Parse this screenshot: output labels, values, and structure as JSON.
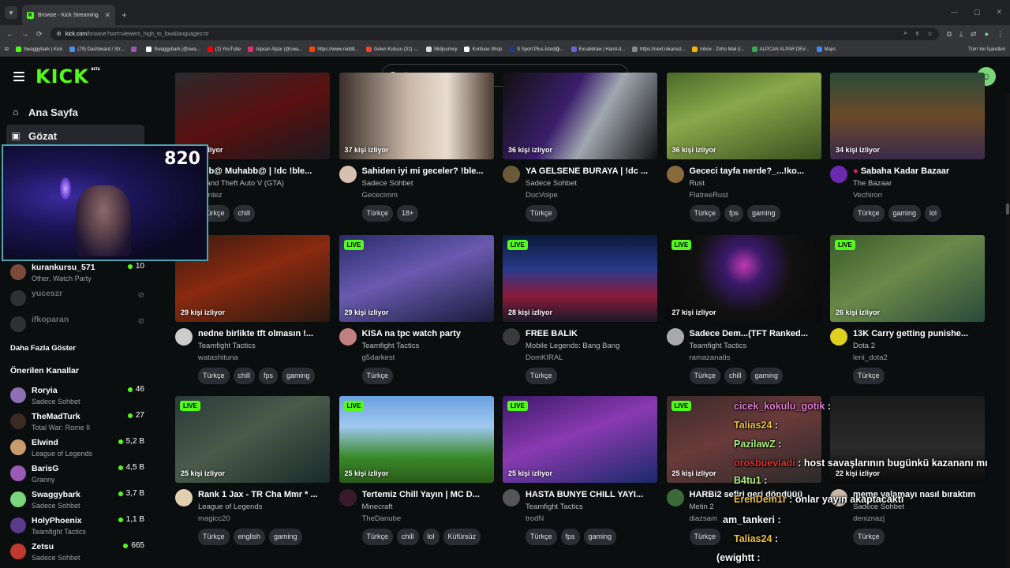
{
  "browser": {
    "tab_title": "Browse - Kick Streaming",
    "url_host": "kick.com",
    "url_path": "/browse?sort=viewers_high_to_low&languages=tr",
    "bookmarks": [
      {
        "label": "Swaggybark | Kick",
        "color": "#53fc18"
      },
      {
        "label": "(79) Dashboard / Str...",
        "color": "#4a90e2"
      },
      {
        "label": "",
        "color": "#9b59b6"
      },
      {
        "label": "Swaggybark (@swa...",
        "color": "#ffffff"
      },
      {
        "label": "(2) YouTube",
        "color": "#ff0000"
      },
      {
        "label": "Alpcan Alpar (@swa...",
        "color": "#e1306c"
      },
      {
        "label": "https://www.reddit...",
        "color": "#ff4500"
      },
      {
        "label": "Gelen Kutusu (31) -...",
        "color": "#ea4335"
      },
      {
        "label": "Midjourney",
        "color": "#dddddd"
      },
      {
        "label": "Konfuse Shop",
        "color": "#ffffff"
      },
      {
        "label": "S Sport Plus-İstediği...",
        "color": "#1e3a8a"
      },
      {
        "label": "Excalidraw | Hand-d...",
        "color": "#6965db"
      },
      {
        "label": "https://next.inkamat...",
        "color": "#888888"
      },
      {
        "label": "Inbox - Zoho Mail (i...",
        "color": "#f4b400"
      },
      {
        "label": "ALPCAN ALPAR DEV...",
        "color": "#34a853"
      },
      {
        "label": "Maps",
        "color": "#4285f4"
      }
    ],
    "bookmarks_right": "Tüm Yer İşaretleri"
  },
  "header": {
    "logo": "KICK",
    "logo_badge": "BETA",
    "search_placeholder": "Ara"
  },
  "sidebar": {
    "nav": [
      {
        "label": "Ana Sayfa",
        "icon": "home-icon",
        "active": false
      },
      {
        "label": "Gözat",
        "icon": "browse-icon",
        "active": true
      }
    ],
    "webcam_count": "820",
    "followed": [
      {
        "name": "kurankursu_571",
        "category": "Other, Watch Party",
        "viewers": "10",
        "online": true,
        "color": "#7a4a3a"
      },
      {
        "name": "yuceszr",
        "category": "",
        "viewers": "",
        "online": false,
        "color": "#555555"
      },
      {
        "name": "ifkoparan",
        "category": "",
        "viewers": "",
        "online": false,
        "color": "#555555"
      }
    ],
    "show_more": "Daha Fazla Göster",
    "recommended_title": "Önerilen Kanallar",
    "recommended": [
      {
        "name": "Roryia",
        "category": "Sadece Sohbet",
        "viewers": "46",
        "color": "#8e6fb5"
      },
      {
        "name": "TheMadTurk",
        "category": "Total War: Rome II",
        "viewers": "27",
        "color": "#3b2a24"
      },
      {
        "name": "Elwind",
        "category": "League of Legends",
        "viewers": "5,2 B",
        "color": "#c69c6d"
      },
      {
        "name": "BarisG",
        "category": "Granny",
        "viewers": "4,5 B",
        "color": "#9b59b6"
      },
      {
        "name": "Swaggybark",
        "category": "Sadece Sohbet",
        "viewers": "3,7 B",
        "color": "#7ad67a"
      },
      {
        "name": "HolyPhoenix",
        "category": "Teamfight Tactics",
        "viewers": "1,1 B",
        "color": "#5a3a8a"
      },
      {
        "name": "Zetsu",
        "category": "Sadece Sohbet",
        "viewers": "665",
        "color": "#c0392b"
      }
    ]
  },
  "cards": [
    {
      "live": false,
      "viewers": "... kişi izliyor",
      "title": "ohb@ Muhabb@ | !dc !ble...",
      "category": "Grand Theft Auto V (GTA)",
      "user": "leontez",
      "tags": [
        "Türkçe",
        "chill"
      ],
      "thumb": "linear-gradient(160deg,#2a2a2e 0%,#5a1010 50%,#1a1a1e 100%)",
      "avatar": "#333"
    },
    {
      "live": false,
      "viewers": "37 kişi izliyor",
      "title": "Sahiden iyi mi geceler? !ble...",
      "category": "Sadece Sohbet",
      "user": "Gececimm",
      "tags": [
        "Türkçe",
        "18+"
      ],
      "thumb": "linear-gradient(90deg,#3a2f2a 0%,#c9b8a8 45%,#e8dcd0 70%,#4a3a30 100%)",
      "avatar": "#d8c0b0"
    },
    {
      "live": false,
      "viewers": "36 kişi izliyor",
      "title": "YA GELSENE BURAYA | !dc ...",
      "category": "Sadece Sohbet",
      "user": "DucVolpe",
      "tags": [
        "Türkçe"
      ],
      "thumb": "linear-gradient(120deg,#111 0%,#3a1e6a 40%,#a0a8b0 60%,#111 100%)",
      "avatar": "#6a5a3a"
    },
    {
      "live": false,
      "viewers": "36 kişi izliyor",
      "title": "Gececi tayfa nerde?_...!ko...",
      "category": "Rust",
      "user": "FlatreeRust",
      "tags": [
        "Türkçe",
        "fps",
        "gaming"
      ],
      "thumb": "linear-gradient(160deg,#4a6a2a 0%,#8aa84a 40%,#3a5020 100%)",
      "avatar": "#8a6a3a"
    },
    {
      "live": false,
      "viewers": "34 kişi izliyor",
      "title": "Sabaha Kadar Bazaar",
      "category": "The Bazaar",
      "user": "Vechiron",
      "tags": [
        "Türkçe",
        "gaming",
        "lol"
      ],
      "thumb": "linear-gradient(180deg,#2a4a3a 0%,#6a4a2a 50%,#3a2a4a 100%)",
      "avatar": "#6a2ab0",
      "title_dot": true
    },
    {
      "live": false,
      "viewers": "29 kişi izliyor",
      "title": "nedne birlikte tft olmasın !...",
      "category": "Teamfight Tactics",
      "user": "watashituna",
      "tags": [
        "Türkçe",
        "chill",
        "fps",
        "gaming"
      ],
      "thumb": "linear-gradient(160deg,#3a1a10 0%,#8a2a10 45%,#2a1a10 100%)",
      "avatar": "#ccc"
    },
    {
      "live": true,
      "viewers": "29 kişi izliyor",
      "title": "KISA na tpc watch party",
      "category": "Teamfight Tactics",
      "user": "g5darkest",
      "tags": [
        "Türkçe"
      ],
      "thumb": "linear-gradient(160deg,#2a2a6a 0%,#6a5ab0 45%,#1a1a3a 100%)",
      "avatar": "#c08080"
    },
    {
      "live": true,
      "viewers": "28 kişi izliyor",
      "title": "FREE BALIK",
      "category": "Mobile Legends: Bang Bang",
      "user": "DomKIRAL",
      "tags": [
        "Türkçe"
      ],
      "thumb": "linear-gradient(180deg,#0a1a3a 0%,#2a3a8a 40%,#8a1a3a 70%,#1a1a2a 100%)",
      "avatar": "#3a3a3a"
    },
    {
      "live": true,
      "viewers": "27 kişi izliyor",
      "title": "Sadece Dem...(TFT Ranked...",
      "category": "Teamfight Tactics",
      "user": "ramazanatis",
      "tags": [
        "Türkçe",
        "chill",
        "gaming"
      ],
      "thumb": "radial-gradient(circle at 50% 35%,#c03ab0 0%,#3a1a6a 20%,#111 50%,#0a0a0a 100%)",
      "avatar": "#aaa"
    },
    {
      "live": true,
      "viewers": "26 kişi izliyor",
      "title": "13K Carry getting punishe...",
      "category": "Dota 2",
      "user": "leni_dota2",
      "tags": [
        "Türkçe"
      ],
      "thumb": "linear-gradient(150deg,#3a5a2a 0%,#6a8a4a 45%,#2a4a3a 100%)",
      "avatar": "#e0d020"
    },
    {
      "live": true,
      "viewers": "25 kişi izliyor",
      "title": "Rank 1 Jax - TR Cha Mmr * ...",
      "category": "League of Legends",
      "user": "magicc20",
      "tags": [
        "Türkçe",
        "english",
        "gaming"
      ],
      "thumb": "linear-gradient(150deg,#2a3a3a 0%,#4a5a4a 45%,#1a2a2a 100%)",
      "avatar": "#e0d0b0"
    },
    {
      "live": true,
      "viewers": "25 kişi izliyor",
      "title": "Tertemiz Chill Yayın | MC D...",
      "category": "Minecraft",
      "user": "TheDanube",
      "tags": [
        "Türkçe",
        "chill",
        "lol",
        "Küfürsüz"
      ],
      "thumb": "linear-gradient(180deg,#6aa0e0 0%,#a0c8f0 35%,#3a8a2a 70%,#2a5a1a 100%)",
      "avatar": "#3a1a2a"
    },
    {
      "live": true,
      "viewers": "25 kişi izliyor",
      "title": "HASTA BUNYE CHILL YAYI...",
      "category": "Teamfight Tactics",
      "user": "trodN",
      "tags": [
        "Türkçe",
        "fps",
        "gaming"
      ],
      "thumb": "linear-gradient(160deg,#3a1a6a 0%,#8a3ab0 45%,#1a2a6a 100%)",
      "avatar": "#555"
    },
    {
      "live": true,
      "viewers": "25 kişi izliyor",
      "title": "HARBi2 sefiri geri döndüüü",
      "category": "Metin 2",
      "user": "diazsam",
      "tags": [
        "Türkçe"
      ],
      "thumb": "linear-gradient(160deg,#3a2a2a 0%,#6a3a3a 45%,#2a2a2a 100%)",
      "avatar": "#3a6a3a"
    },
    {
      "live": false,
      "viewers": "22 kişi izliyor",
      "title": "meme yalamayı nasıl bıraktım",
      "category": "Sadece Sohbet",
      "user": "deniznazj",
      "tags": [
        "Türkçe"
      ],
      "thumb": "linear-gradient(180deg,#1a1a1a 0%,#2a2a2a 60%,#0a0a0a 100%)",
      "avatar": "#c8b8a8"
    }
  ],
  "chat": [
    {
      "user": "cicek_kokulu_gotik",
      "user_color": "#e07ad0",
      "msg": ""
    },
    {
      "user": "Talias24",
      "user_color": "#f0c040",
      "msg": ""
    },
    {
      "user": "PazilawZ",
      "user_color": "#b0f080",
      "msg": ""
    },
    {
      "user": "orosbuevladi",
      "user_color": "#e03030",
      "msg": "host savaşlarının bugünkü kazananı mı"
    },
    {
      "user": "B4tu1",
      "user_color": "#b0f080",
      "msg": ""
    },
    {
      "user": "ErenDem1r",
      "user_color": "#f0c040",
      "msg": "onlar yayın akaptacaktı"
    },
    {
      "user": "am_tankeri",
      "user_color": "#ffffff",
      "msg": ""
    },
    {
      "user": "Talias24",
      "user_color": "#f0c040",
      "msg": ""
    },
    {
      "user": "(ewightt",
      "user_color": "#ffffff",
      "msg": ""
    }
  ]
}
